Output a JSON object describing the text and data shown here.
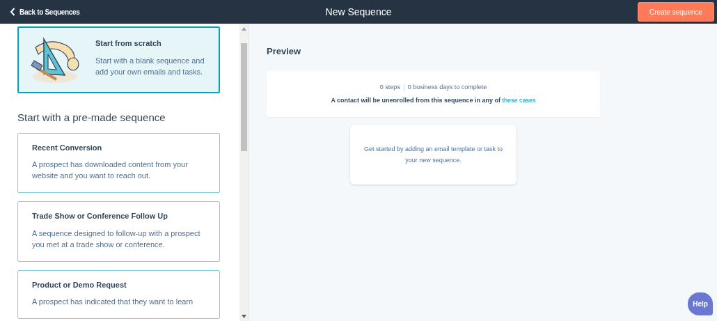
{
  "navbar": {
    "back_link": "Back to Sequences",
    "title": "New Sequence",
    "create_button": "Create sequence"
  },
  "scratch_card": {
    "title": "Start from scratch",
    "description": "Start with a blank sequence and add your own emails and tasks.",
    "selected": true
  },
  "premade": {
    "heading": "Start with a pre-made sequence",
    "templates": [
      {
        "title": "Recent Conversion",
        "description": "A prospect has downloaded content from your website and you want to reach out.",
        "selected": false
      },
      {
        "title": "Trade Show or Conference Follow Up",
        "description": "A sequence designed to follow-up with a prospect you met at a trade show or conference.",
        "selected": false
      },
      {
        "title": "Product or Demo Request",
        "description": "A prospect has indicated that they want to learn",
        "selected": false
      }
    ]
  },
  "preview": {
    "heading": "Preview",
    "steps": "0 steps",
    "days": "0 business days to complete",
    "unenroll_text": "A contact will be unenrolled from this sequence in any of",
    "unenroll_link": "these cases",
    "empty_message": "Get started by adding an email template or task to your new sequence."
  },
  "help_button": "Help"
}
